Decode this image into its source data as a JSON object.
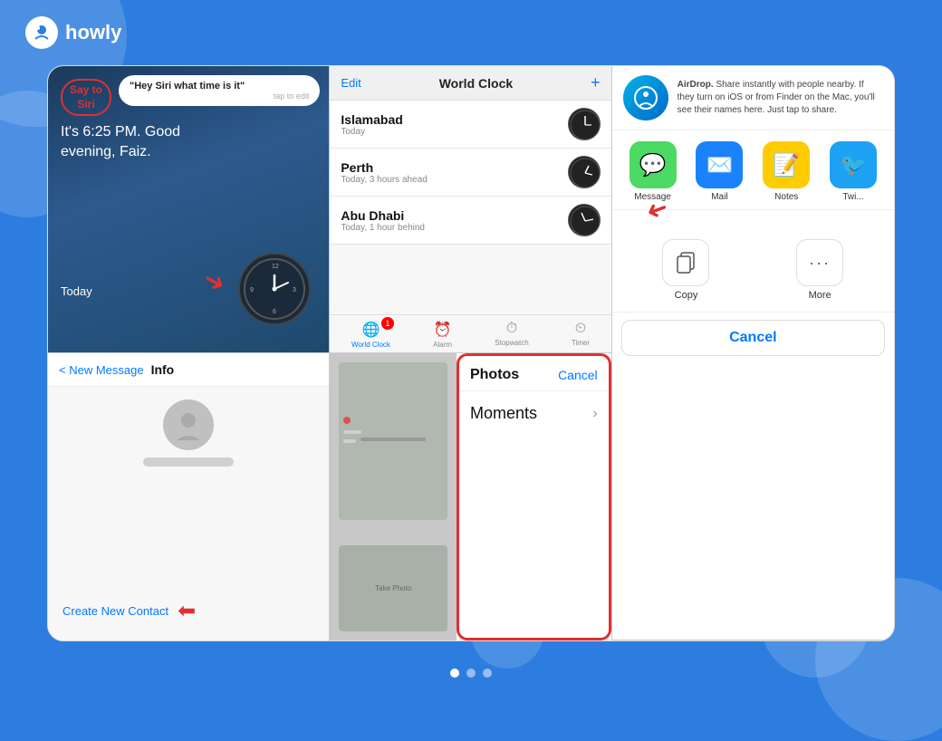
{
  "brand": {
    "logo_alt": "howly mascot",
    "name": "howly"
  },
  "panel_siri": {
    "say_to_siri": "Say to\nSiri",
    "prompt": "\"Hey Siri what time is it\"",
    "tap_to_edit": "tap to edit",
    "response_line1": "It's 6:25 PM. Good",
    "response_line2": "evening, Faiz.",
    "today_label": "Today"
  },
  "panel_worldclock": {
    "edit_label": "Edit",
    "title": "World Clock",
    "add_icon": "+",
    "cities": [
      {
        "name": "Islamabad",
        "time_info": "Today"
      },
      {
        "name": "Perth",
        "time_info": "Today, 3 hours ahead"
      },
      {
        "name": "Abu Dhabi",
        "time_info": "Today, 1 hour behind"
      }
    ],
    "tabs": [
      {
        "label": "World Clock",
        "active": true,
        "icon": "🌐"
      },
      {
        "label": "Alarm",
        "active": false,
        "icon": "⏰"
      },
      {
        "label": "Stopwatch",
        "active": false,
        "icon": "⏱"
      },
      {
        "label": "Timer",
        "active": false,
        "icon": "⏲"
      }
    ],
    "badge": "1"
  },
  "panel_share": {
    "airdrop_title": "AirDrop.",
    "airdrop_desc": "Share instantly with people nearby. If they turn on iOS or from Finder on the Mac, you'll see their names here. Just tap to share.",
    "apps": [
      {
        "label": "Message",
        "color": "#4cd964",
        "icon": "💬"
      },
      {
        "label": "Mail",
        "color": "#1a82fb",
        "icon": "✉️"
      },
      {
        "label": "Notes",
        "color": "#ffcc00",
        "icon": "📝"
      },
      {
        "label": "Twi...",
        "color": "#1da1f2",
        "icon": "🐦"
      }
    ],
    "actions": [
      {
        "label": "Copy",
        "icon": "⎘"
      },
      {
        "label": "More",
        "icon": "•••"
      }
    ],
    "cancel_label": "Cancel"
  },
  "panel_contact": {
    "back_label": "< New Message",
    "title": "Info",
    "create_contact_label": "Create New Contact"
  },
  "panel_photos": {
    "title": "Photos",
    "cancel_label": "Cancel",
    "moments_label": "Moments"
  }
}
